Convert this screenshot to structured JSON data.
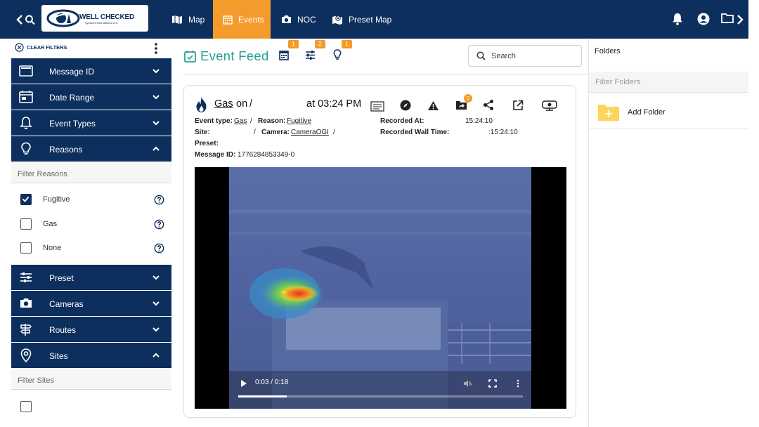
{
  "topbar": {
    "back_icon": "chevron-left-icon",
    "search_icon": "search-icon",
    "logo": {
      "line1": "WELL CHECKED",
      "line2": "Systems International LLC"
    },
    "nav": [
      {
        "label": "Map",
        "icon": "map-icon"
      },
      {
        "label": "Events",
        "icon": "calendar-icon",
        "active": true
      },
      {
        "label": "NOC",
        "icon": "camera-icon"
      },
      {
        "label": "Preset Map",
        "icon": "map-marker-icon"
      }
    ],
    "right_icons": [
      "bell-icon",
      "account-icon",
      "folder-icon",
      "chevron-right-icon"
    ]
  },
  "sidebar": {
    "clear_filters": "CLEAR FILTERS",
    "sections": [
      {
        "label": "Message ID",
        "icon": "id-card-icon",
        "expanded": false
      },
      {
        "label": "Date Range",
        "icon": "calendar-icon",
        "expanded": false
      },
      {
        "label": "Event Types",
        "icon": "bell-icon",
        "expanded": false
      },
      {
        "label": "Reasons",
        "icon": "lightbulb-icon",
        "expanded": true
      },
      {
        "label": "Preset",
        "icon": "sliders-icon",
        "expanded": false
      },
      {
        "label": "Cameras",
        "icon": "camera-icon",
        "expanded": false
      },
      {
        "label": "Routes",
        "icon": "signpost-icon",
        "expanded": false
      },
      {
        "label": "Sites",
        "icon": "location-pin-icon",
        "expanded": true
      }
    ],
    "reasons": {
      "filter_placeholder": "Filter Reasons",
      "options": [
        {
          "label": "Fugitive",
          "checked": true
        },
        {
          "label": "Gas",
          "checked": false
        },
        {
          "label": "None",
          "checked": false
        }
      ]
    },
    "sites": {
      "filter_placeholder": "Filter Sites",
      "options": [
        {
          "label": "",
          "checked": false
        }
      ]
    }
  },
  "feed": {
    "title": "Event Feed",
    "badges": [
      "1",
      "2",
      "1"
    ],
    "search_placeholder": "Search"
  },
  "event": {
    "title_type": "Gas",
    "title_on": "on",
    "title_slash": "/",
    "title_time": "at 03:24 PM",
    "folder_count": "0",
    "event_type_label": "Event type:",
    "event_type": "Gas",
    "reason_label": "Reason:",
    "reason": "Fugitive",
    "site_label": "Site:",
    "camera_label": "Camera:",
    "camera": "CameraOGI",
    "preset_label": "Preset:",
    "message_id_label": "Message ID:",
    "message_id": "1776284853349-0",
    "recorded_at_label": "Recorded At:",
    "recorded_at": "15:24:10",
    "recorded_wall_label": "Recorded Wall Time:",
    "recorded_wall": ":15:24:10",
    "video": {
      "time": "0:03 / 0:18",
      "progress": 0.17
    }
  },
  "folders": {
    "title": "Folders",
    "filter_placeholder": "Filter Folders",
    "add_label": "Add Folder"
  },
  "colors": {
    "navy": "#0d2f5e",
    "orange": "#f49b2c",
    "teal": "#27a08e",
    "folder_yellow": "#fcd55c"
  }
}
